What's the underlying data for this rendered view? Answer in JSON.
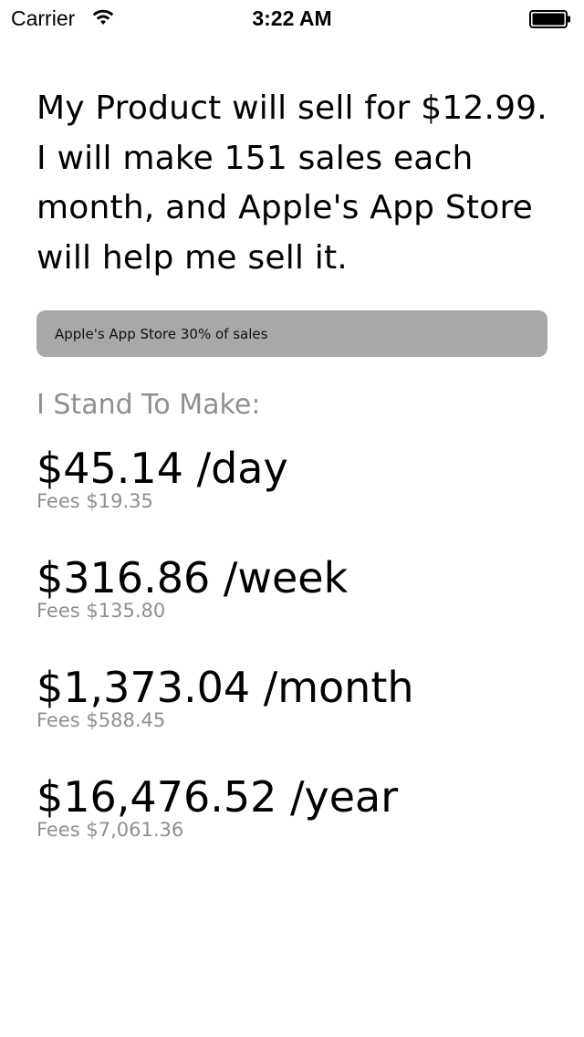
{
  "status_bar": {
    "carrier": "Carrier",
    "time": "3:22 AM",
    "wifi_icon": "wifi-icon",
    "battery_icon": "battery-icon"
  },
  "main": {
    "sentence_lines": [
      "My Product will sell for $12.99.",
      "I will make 151 sales each",
      "month, and Apple's App Store",
      "will help me sell it."
    ],
    "fee_bar": {
      "label": "Apple's App Store 30% of sales",
      "color": "#a8a8a8"
    },
    "stand_label": "I Stand To Make:",
    "periods": [
      {
        "amount": "$45.14 /day",
        "fees": "Fees $19.35"
      },
      {
        "amount": "$316.86 /week",
        "fees": "Fees $135.80"
      },
      {
        "amount": "$1,373.04 /month",
        "fees": "Fees $588.45"
      },
      {
        "amount": "$16,476.52 /year",
        "fees": "Fees $7,061.36"
      }
    ]
  },
  "colors": {
    "background": "#ffffff",
    "text": "#000000",
    "muted_text": "#8f8f8f"
  }
}
